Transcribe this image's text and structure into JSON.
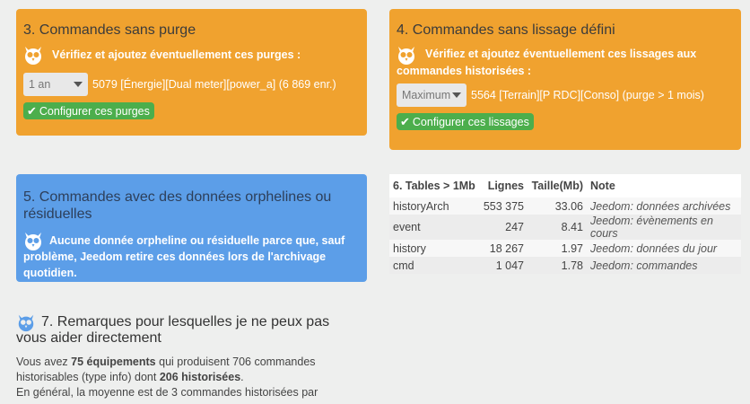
{
  "card3": {
    "title": "3. Commandes sans purge",
    "message": "Vérifiez et ajoutez éventuellement ces purges :",
    "select_value": "1 an",
    "command": "5079 [Énergie][Dual meter][power_a] (6 869 enr.)",
    "button_label": "Configurer ces purges"
  },
  "card4": {
    "title": "4. Commandes sans lissage défini",
    "message_line1": "Vérifiez et ajoutez éventuellement ces lissages aux",
    "message_line2": "commandes historisées :",
    "select_value": "Maximum",
    "command": "5564 [Terrain][P RDC][Conso] (purge > 1 mois)",
    "button_label": "Configurer ces lissages"
  },
  "card5": {
    "title_line1": "5. Commandes avec des données orphelines ou",
    "title_line2": "résiduelles",
    "message_line1": "Aucune donnée orpheline ou résiduelle parce que, sauf",
    "message_line2": "problème, Jeedom retire ces données lors de l'archivage quotidien."
  },
  "table6": {
    "headers": [
      "6. Tables > 1Mb",
      "Lignes",
      "Taille(Mb)",
      "Note"
    ],
    "rows": [
      {
        "name": "historyArch",
        "lines": "553 375",
        "size": "33.06",
        "note": "Jeedom: données archivées"
      },
      {
        "name": "event",
        "lines": "247",
        "size": "8.41",
        "note": "Jeedom: évènements en cours"
      },
      {
        "name": "history",
        "lines": "18 267",
        "size": "1.97",
        "note": "Jeedom: données du jour"
      },
      {
        "name": "cmd",
        "lines": "1 047",
        "size": "1.78",
        "note": "Jeedom: commandes"
      }
    ]
  },
  "section7": {
    "title_line1": "7. Remarques pour lesquelles je ne peux pas",
    "title_line2": "vous aider directement",
    "p1_a": "Vous avez ",
    "p1_equip": "75 équipements",
    "p1_b": " qui produisent 706 commandes",
    "p1_c": "historisables (type info) dont ",
    "p1_hist": "206 historisées",
    "p1_d": ".",
    "p2": "En général, la moyenne est de 3 commandes historisées par"
  },
  "icons": {
    "owl": "owl-icon",
    "check": "check-icon",
    "caret": "caret-down-icon"
  },
  "colors": {
    "orange": "#f0a22f",
    "blue": "#5c9ee8",
    "green": "#4cae4c"
  }
}
